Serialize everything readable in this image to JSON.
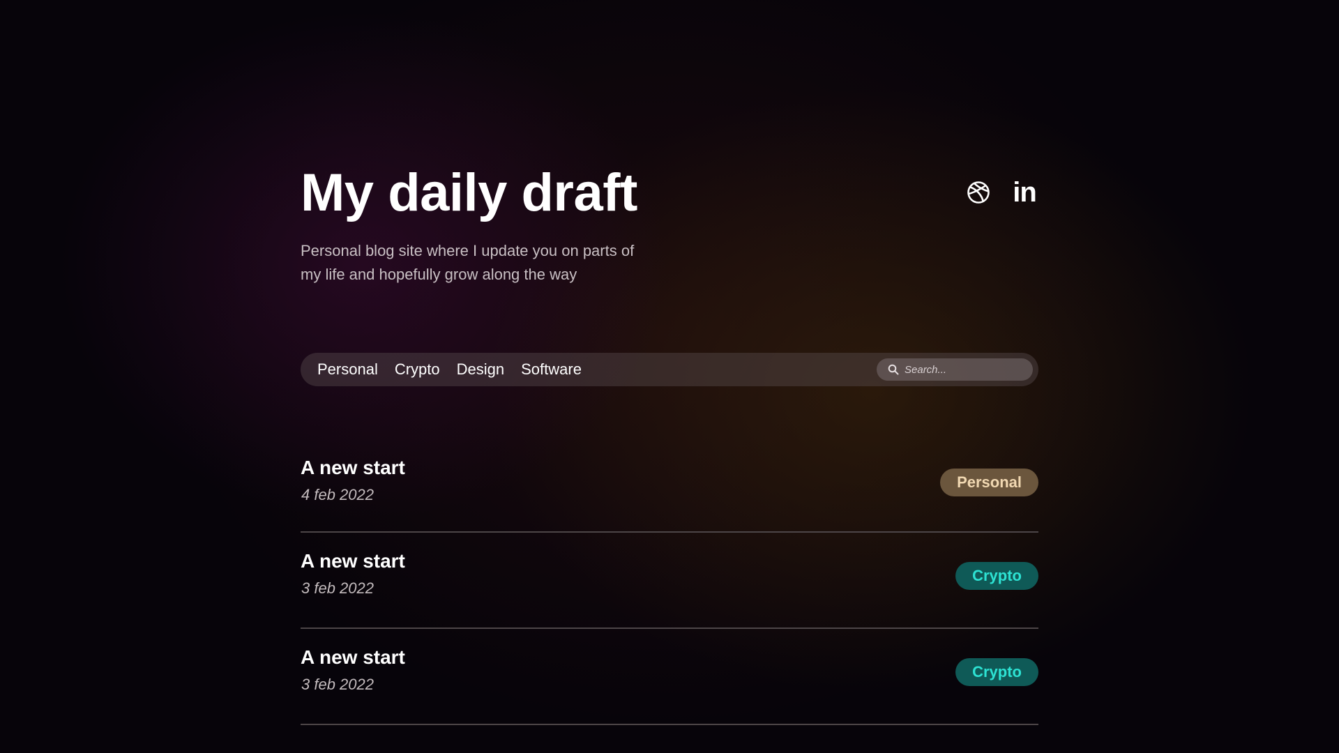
{
  "header": {
    "title": "My daily draft",
    "subtitle": "Personal blog site where I update you on parts of my life and hopefully grow along the way",
    "socials": [
      {
        "icon": "dribbble-icon"
      },
      {
        "icon": "linkedin-icon",
        "glyph": "in"
      }
    ]
  },
  "nav": {
    "links": [
      {
        "label": "Personal"
      },
      {
        "label": "Crypto"
      },
      {
        "label": "Design"
      },
      {
        "label": "Software"
      }
    ],
    "search": {
      "placeholder": "Search...",
      "value": ""
    }
  },
  "posts": [
    {
      "title": "A new start",
      "date": "4 feb 2022",
      "tag": "Personal"
    },
    {
      "title": "A new start",
      "date": "3 feb 2022",
      "tag": "Crypto"
    },
    {
      "title": "A new start",
      "date": "3 feb 2022",
      "tag": "Crypto"
    }
  ],
  "colors": {
    "personal_tag_bg": "#6b563d",
    "personal_tag_text": "#f1d8b2",
    "crypto_tag_bg": "#0f5a57",
    "crypto_tag_text": "#2de2d3"
  }
}
